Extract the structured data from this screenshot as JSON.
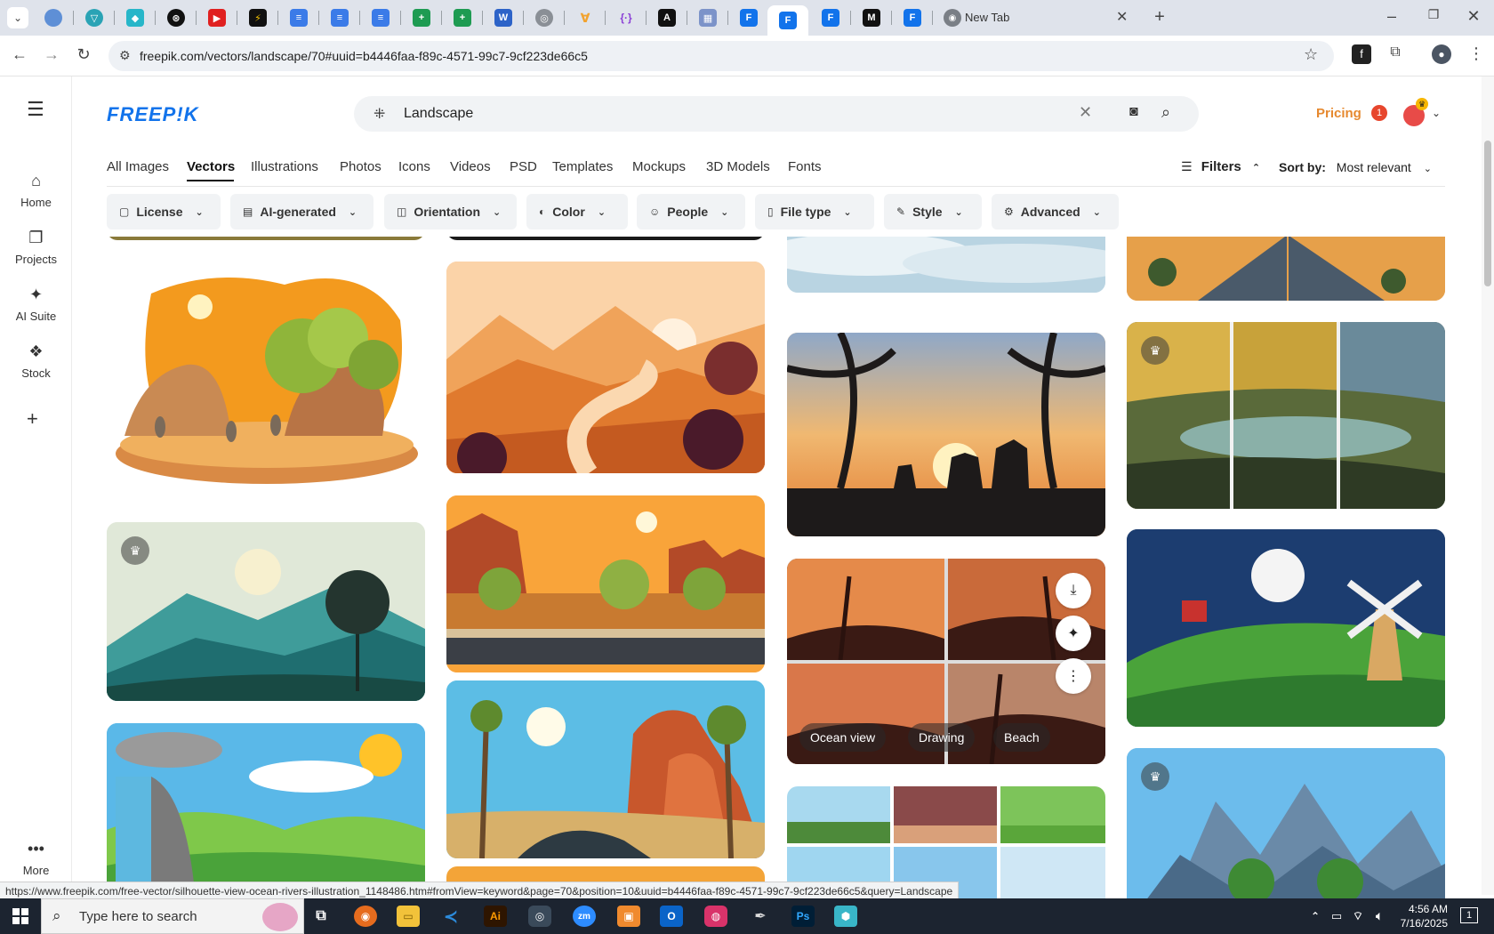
{
  "browser": {
    "new_tab_title": "New Tab",
    "url": "freepik.com/vectors/landscape/70#uuid=b4446faa-f89c-4571-99c7-9cf223de66c5",
    "status_url": "https://www.freepik.com/free-vector/silhouette-view-ocean-rivers-illustration_1148486.htm#fromView=keyword&page=70&position=10&uuid=b4446faa-f89c-4571-99c7-9cf223de66c5&query=Landscape"
  },
  "site": {
    "logo": "FREEP!K",
    "search_value": "Landscape",
    "pricing": "Pricing",
    "notification_count": "1"
  },
  "sidebar": {
    "items": [
      {
        "label": "Home",
        "icon": "home-icon"
      },
      {
        "label": "Projects",
        "icon": "projects-icon"
      },
      {
        "label": "AI Suite",
        "icon": "sparkle-icon"
      },
      {
        "label": "Stock",
        "icon": "stock-icon"
      }
    ],
    "more": "More"
  },
  "categories": [
    "All Images",
    "Vectors",
    "Illustrations",
    "Photos",
    "Icons",
    "Videos",
    "PSD",
    "Templates",
    "Mockups",
    "3D Models",
    "Fonts"
  ],
  "filters_label": "Filters",
  "sort": {
    "label": "Sort by:",
    "value": "Most relevant"
  },
  "chips": [
    "License",
    "AI-generated",
    "Orientation",
    "Color",
    "People",
    "File type",
    "Style",
    "Advanced"
  ],
  "hover_tags": [
    "Ocean view",
    "Drawing",
    "Beach"
  ],
  "taskbar": {
    "search_placeholder": "Type here to search",
    "time": "4:56 AM",
    "date": "7/16/2025",
    "notifications": "1"
  }
}
